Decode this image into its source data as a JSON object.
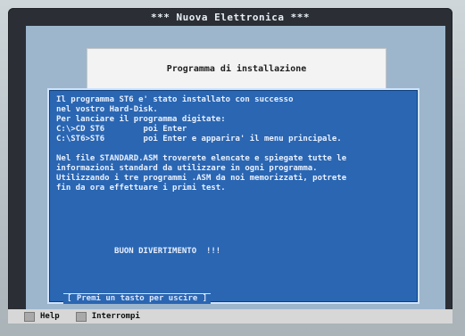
{
  "titlebar": {
    "title": "*** Nuova Elettronica ***"
  },
  "banner": {
    "text": "Programma di installazione"
  },
  "dialog": {
    "lines": [
      "Il programma ST6 e' stato installato con successo",
      "nel vostro Hard-Disk.",
      "Per lanciare il programma digitate:",
      "C:\\>CD ST6        poi Enter",
      "C:\\ST6>ST6        poi Enter e apparira' il menu principale.",
      "",
      "Nel file STANDARD.ASM troverete elencate e spiegate tutte le",
      "informazioni standard da utilizzare in ogni programma.",
      "Utilizzando i tre programmi .ASM da noi memorizzati, potrete",
      "fin da ora effettuare i primi test.",
      "",
      "",
      "",
      "",
      "",
      "            BUON DIVERTIMENTO  !!!"
    ],
    "prompt": "[ Premi un tasto per uscire ]"
  },
  "statusbar": {
    "help": "Help",
    "interrompi": "Interrompi"
  }
}
